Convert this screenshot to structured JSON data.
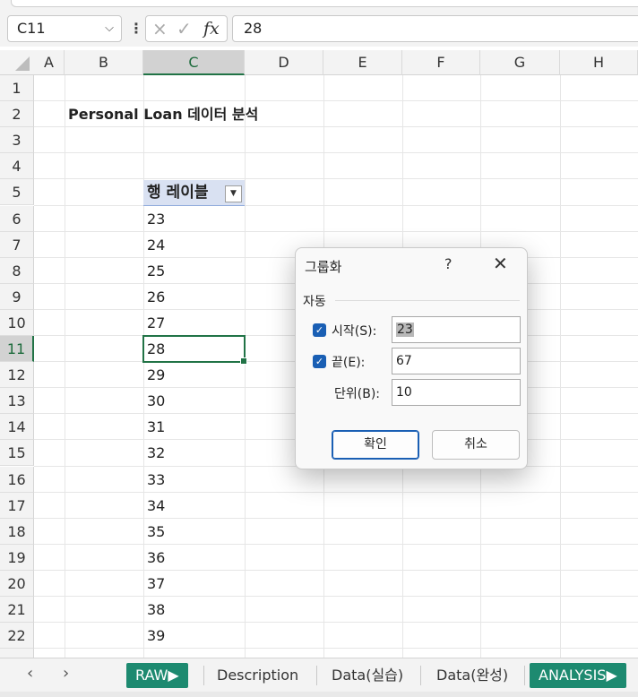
{
  "formula_bar": {
    "name_box": "C11",
    "cancel_icon": "×",
    "enter_icon": "✓",
    "fx_label": "fx",
    "value": "28"
  },
  "columns": [
    "A",
    "B",
    "C",
    "D",
    "E",
    "F",
    "G",
    "H"
  ],
  "selected_column": "C",
  "rows": [
    "1",
    "2",
    "3",
    "4",
    "5",
    "6",
    "7",
    "8",
    "9",
    "10",
    "11",
    "12",
    "13",
    "14",
    "15",
    "16",
    "17",
    "18",
    "19",
    "20",
    "21",
    "22"
  ],
  "selected_row": "11",
  "sheet": {
    "title": "Personal Loan 데이터 분석",
    "pivot_header": "행 레이블",
    "pivot_values": [
      "23",
      "24",
      "25",
      "26",
      "27",
      "28",
      "29",
      "30",
      "31",
      "32",
      "33",
      "34",
      "35",
      "36",
      "37",
      "38",
      "39"
    ]
  },
  "dialog": {
    "title": "그룹화",
    "help": "?",
    "close": "✕",
    "group_label": "자동",
    "start_label": "시작(S):",
    "start_value": "23",
    "start_checked": true,
    "end_label": "끝(E):",
    "end_value": "67",
    "end_checked": true,
    "by_label": "단위(B):",
    "by_value": "10",
    "ok_label": "확인",
    "cancel_label": "취소"
  },
  "tabs": {
    "prev": "‹",
    "next": "›",
    "items": [
      "RAW▶",
      "Description",
      "Data(실습)",
      "Data(완성)",
      "ANALYSIS▶"
    ]
  },
  "colors": {
    "accent_green": "#217346",
    "tab_green": "#1d8a70",
    "pivot_header_bg": "#d9e1f2",
    "dialog_accent": "#1a5fb4"
  }
}
